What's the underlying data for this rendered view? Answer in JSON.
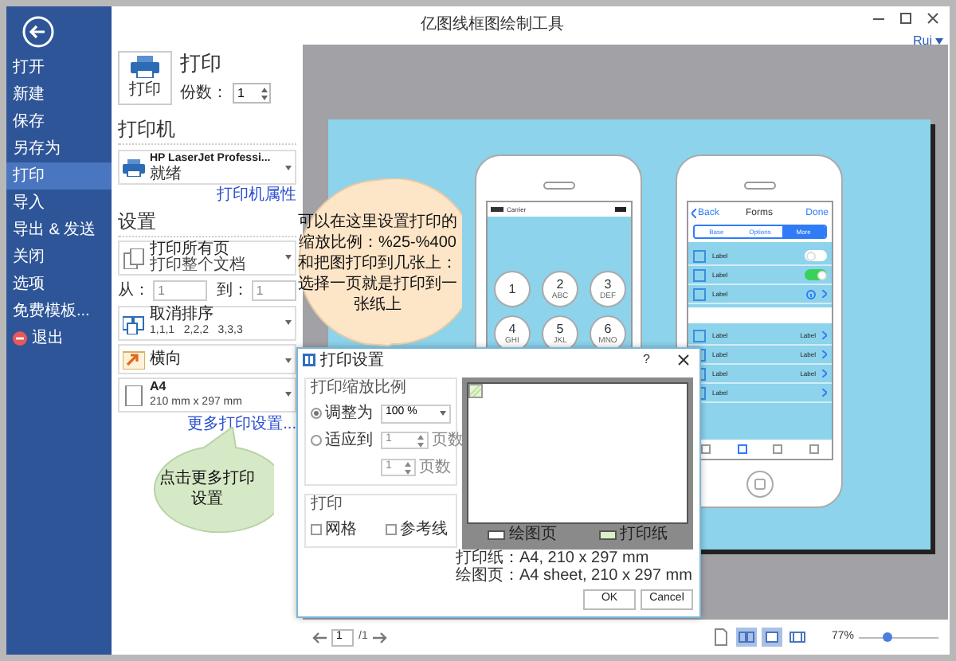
{
  "window": {
    "title": "亿图线框图绘制工具",
    "user": "Rui"
  },
  "sidebar": {
    "items": [
      {
        "label": "打开",
        "selected": false,
        "kind": "plain"
      },
      {
        "label": "新建",
        "selected": false,
        "kind": "plain"
      },
      {
        "label": "保存",
        "selected": false,
        "kind": "plain"
      },
      {
        "label": "另存为",
        "selected": false,
        "kind": "plain"
      },
      {
        "label": "打印",
        "selected": true,
        "kind": "plain"
      },
      {
        "label": "导入",
        "selected": false,
        "kind": "plain"
      },
      {
        "label": "导出 & 发送",
        "selected": false,
        "kind": "plain"
      },
      {
        "label": "关闭",
        "selected": false,
        "kind": "plain"
      },
      {
        "label": "选项",
        "selected": false,
        "kind": "plain"
      },
      {
        "label": "免费模板...",
        "selected": false,
        "kind": "plain"
      },
      {
        "label": "退出",
        "selected": false,
        "kind": "exit"
      }
    ]
  },
  "print_panel": {
    "button": "打印",
    "heading": "打印",
    "copies_label": "份数：",
    "copies": "1",
    "printer_heading": "打印机",
    "printer": {
      "name": "HP LaserJet Professi...",
      "status": "就绪"
    },
    "printer_link": "打印机属性",
    "settings_heading": "设置",
    "settings": [
      {
        "kind": "pages",
        "title": "打印所有页",
        "subtitle": "打印整个文档"
      },
      {
        "kind": "range",
        "from_label": "从：",
        "from": "1",
        "to_label": "到：",
        "to": "1"
      },
      {
        "kind": "collate",
        "title": "取消排序",
        "subtitle": "1,1,1   2,2,2   3,3,3"
      },
      {
        "kind": "orientation",
        "title": "横向"
      },
      {
        "kind": "paper",
        "title": "A4",
        "subtitle": "210 mm x 297 mm"
      }
    ],
    "more_link": "更多打印设置..."
  },
  "preview": {
    "left_phone": {
      "carrier": "Carrier",
      "keys": [
        {
          "digit": "1"
        },
        {
          "digit": "2",
          "letters": "ABC"
        },
        {
          "digit": "3",
          "letters": "DEF"
        },
        {
          "digit": "4",
          "letters": "GHI"
        },
        {
          "digit": "5",
          "letters": "JKL"
        },
        {
          "digit": "6",
          "letters": "MNO"
        }
      ]
    },
    "right_phone": {
      "back": "Back",
      "title": "Forms",
      "done": "Done",
      "segments": [
        {
          "label": "Base",
          "selected": false
        },
        {
          "label": "Options",
          "selected": false
        },
        {
          "label": "More",
          "selected": true
        }
      ],
      "rows": [
        {
          "kind": "toggle",
          "label": "Label",
          "on": false
        },
        {
          "kind": "toggle",
          "label": "Label",
          "on": true
        },
        {
          "kind": "info",
          "label": "Label"
        },
        {
          "kind": "gap"
        },
        {
          "kind": "detail",
          "label": "Label",
          "detail": "Label"
        },
        {
          "kind": "detail",
          "label": "Label",
          "detail": "Label"
        },
        {
          "kind": "detail",
          "label": "Label",
          "detail": "Label"
        },
        {
          "kind": "chevron",
          "label": "Label"
        }
      ]
    }
  },
  "bottom_bar": {
    "page": "1",
    "total": "/1",
    "views": [
      {
        "kind": "page",
        "selected": false
      },
      {
        "kind": "two",
        "selected": true
      },
      {
        "kind": "one",
        "selected": true
      },
      {
        "kind": "fit",
        "selected": false
      }
    ],
    "zoom": "77%",
    "zoom_slider": {
      "level": 0.35
    }
  },
  "dialog": {
    "title": "打印设置",
    "help": "?",
    "scale_group": "打印缩放比例",
    "options": [
      {
        "label": "调整为",
        "selected": true
      },
      {
        "label": "适应到",
        "selected": false
      }
    ],
    "scale_value": "100 %",
    "fit_rows": [
      {
        "value": "1",
        "unit": "页数"
      },
      {
        "value": "1",
        "unit": "页数"
      }
    ],
    "print_group": "打印",
    "checks": [
      {
        "label": "网格",
        "checked": false
      },
      {
        "label": "参考线",
        "checked": false
      }
    ],
    "legend": [
      {
        "label": "绘图页",
        "color": "#ffffff"
      },
      {
        "label": "打印纸",
        "color": "#d9f0c8"
      }
    ],
    "info": [
      "打印纸：A4, 210 x 297 mm",
      "绘图页：A4 sheet, 210 x 297 mm"
    ],
    "buttons": [
      "OK",
      "Cancel"
    ]
  },
  "callouts": [
    {
      "kind": "round",
      "lines": [
        "可以在这里设置打印的",
        "缩放比例：%25-%400",
        "和把图打印到几张上：",
        "选择一页就是打印到一",
        "张纸上"
      ]
    },
    {
      "kind": "oval",
      "lines": [
        "点击更多打印",
        "设置"
      ]
    }
  ]
}
